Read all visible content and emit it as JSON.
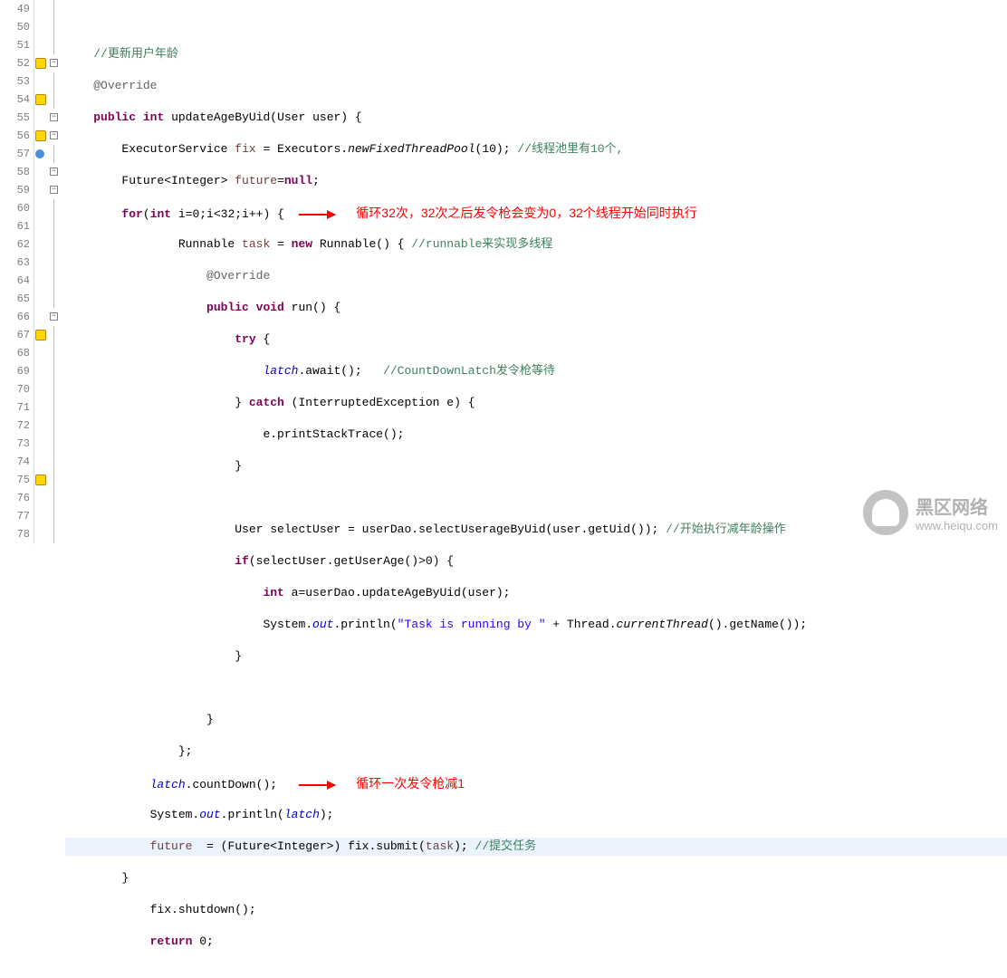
{
  "lines": {
    "start": 49,
    "end": 78
  },
  "code": {
    "l49": "",
    "l50_comment": "//更新用户年龄",
    "l51_annot": "@Override",
    "l52_kw1": "public",
    "l52_kw2": "int",
    "l52_method": "updateAgeByUid",
    "l52_param": "(User user) {",
    "l53_type": "ExecutorService",
    "l53_var": "fix",
    "l53_eq": " = Executors.",
    "l53_call": "newFixedThreadPool",
    "l53_arg": "(10); ",
    "l53_comment": "//线程池里有10个,",
    "l54_type1": "Future<Integer> ",
    "l54_var": "future",
    "l54_eq": "=",
    "l54_kw": "null",
    "l54_end": ";",
    "l55_kw1": "for",
    "l55_p1": "(",
    "l55_kw2": "int",
    "l55_cond": " i=0;i<32;i++) { ",
    "l56_type1": "Runnable ",
    "l56_var": "task",
    "l56_eq": " = ",
    "l56_kw": "new",
    "l56_call": " Runnable() { ",
    "l56_comment": "//runnable来实现多线程",
    "l57_annot": "@Override",
    "l58_kw1": "public",
    "l58_kw2": "void",
    "l58_method": " run() {",
    "l59_kw": "try",
    "l59_brace": " {",
    "l60_var": "latch",
    "l60_call": ".await();   ",
    "l60_comment": "//CountDownLatch发令枪等待",
    "l61_brace": "} ",
    "l61_kw": "catch",
    "l61_params": " (InterruptedException e) {",
    "l62_call": "e.printStackTrace();",
    "l63_brace": "}",
    "l64": "",
    "l65_code": "User selectUser = userDao.selectUserageByUid(user.getUid()); ",
    "l65_comment": "//开始执行减年龄操作",
    "l66_kw": "if",
    "l66_cond": "(selectUser.getUserAge()>0) {",
    "l67_kw": "int",
    "l67_code": " a=userDao.updateAgeByUid(user);",
    "l68_sys": "System.",
    "l68_out": "out",
    "l68_p": ".println(",
    "l68_str": "\"Task is running by \"",
    "l68_rest": " + Thread.",
    "l68_ct": "currentThread",
    "l68_end": "().getName());",
    "l69_brace": "}",
    "l70": "",
    "l71_brace": "}",
    "l72_brace": "};",
    "l73_var": "latch",
    "l73_call": ".countDown();  ",
    "l74_sys": "System.",
    "l74_out": "out",
    "l74_p": ".println(",
    "l74_var2": "latch",
    "l74_end": ");",
    "l75_var": "future",
    "l75_eq": "  = (Future<Integer>) fix.submit(",
    "l75_var2": "task",
    "l75_end": "); ",
    "l75_comment": "//提交任务",
    "l76_brace": "}",
    "l77_call": "fix.shutdown();",
    "l78_kw": "return",
    "l78_val": " 0;"
  },
  "annotations": {
    "a1": "循环32次，32次之后发令枪会变为0，32个线程开始同时执行",
    "a2": "循环一次发令枪减1"
  },
  "watermark": {
    "title": "黑区网络",
    "url": "www.heiqu.com"
  },
  "markers": {
    "warning_lines": [
      52,
      54,
      56,
      67,
      75
    ],
    "override_lines": [
      57
    ]
  }
}
